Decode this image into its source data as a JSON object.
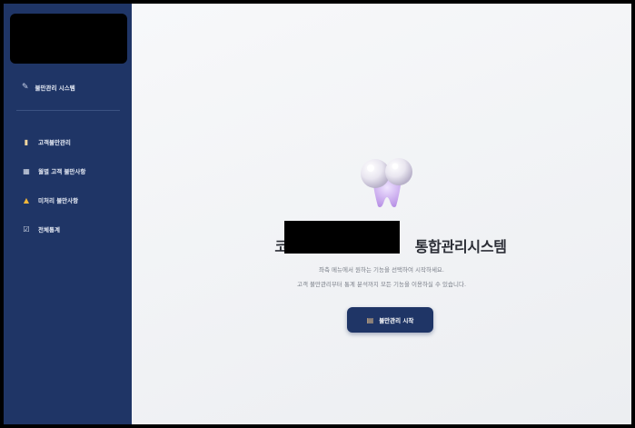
{
  "sidebar": {
    "title": "불만관리 시스템",
    "title_icon": "pencil-icon",
    "items": [
      {
        "label": "고객불만관리",
        "icon": "clipboard-icon"
      },
      {
        "label": "월별 고객 불만사항",
        "icon": "calendar-icon"
      },
      {
        "label": "미처리 불만사항",
        "icon": "warning-icon"
      },
      {
        "label": "전체통계",
        "icon": "chart-icon"
      }
    ]
  },
  "main": {
    "title_visible": "통합관리시스템",
    "description_line1": "좌측 메뉴에서 원하는 기능을 선택하여 시작하세요.",
    "description_line2": "고객 불만관리부터 통계 분석까지 모든 기능을 이용하실 수 있습니다.",
    "start_button": "불만관리 시작",
    "start_button_icon": "document-icon"
  },
  "colors": {
    "sidebar_bg": "#1f3566",
    "main_bg": "#f2f3f5",
    "button_bg": "#1f3566",
    "warning": "#f3b73a"
  }
}
